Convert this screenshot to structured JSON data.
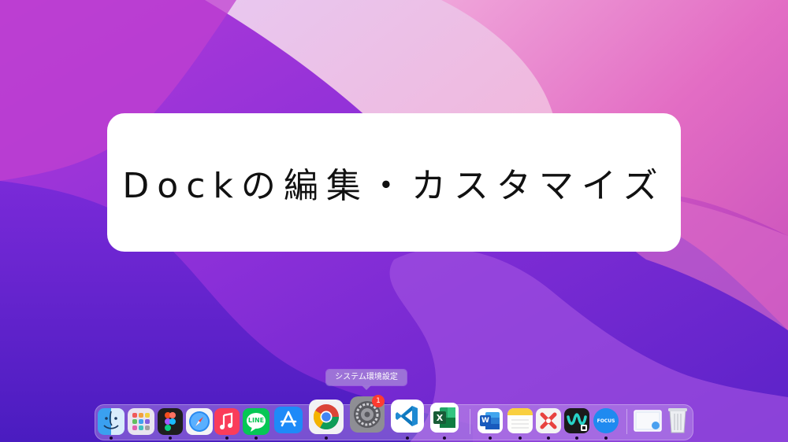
{
  "title": {
    "text": "Dockの編集・カスタマイズ"
  },
  "tooltip": {
    "text": "システム環境設定"
  },
  "dock": {
    "apps": [
      {
        "name": "Finder",
        "icon": "finder-icon",
        "running": true
      },
      {
        "name": "Launchpad",
        "icon": "launchpad-icon",
        "running": false
      },
      {
        "name": "Figma",
        "icon": "figma-icon",
        "running": true
      },
      {
        "name": "Safari",
        "icon": "safari-icon",
        "running": false
      },
      {
        "name": "Music",
        "icon": "music-icon",
        "running": true
      },
      {
        "name": "LINE",
        "icon": "line-icon",
        "label": "LINE",
        "running": true
      },
      {
        "name": "App Store",
        "icon": "app-store-icon",
        "running": false
      },
      {
        "name": "Chrome",
        "icon": "chrome-icon",
        "running": true
      },
      {
        "name": "System Preferences",
        "icon": "system-preferences-icon",
        "badge": "1",
        "running": false
      },
      {
        "name": "Visual Studio Code",
        "icon": "vscode-icon",
        "running": true
      },
      {
        "name": "Excel",
        "icon": "excel-icon",
        "label": "X",
        "running": true
      },
      {
        "name": "Word",
        "icon": "word-icon",
        "label": "W",
        "running": true
      },
      {
        "name": "Notes",
        "icon": "notes-icon",
        "running": true
      },
      {
        "name": "Xmind",
        "icon": "xmind-icon",
        "running": true
      },
      {
        "name": "Webex",
        "icon": "webex-icon",
        "running": true
      },
      {
        "name": "Focus",
        "icon": "focus-icon",
        "label": "FOCUS",
        "running": true
      },
      {
        "name": "Screenshot",
        "icon": "screenshot-stack-icon",
        "running": false
      },
      {
        "name": "Trash",
        "icon": "trash-icon",
        "running": false
      }
    ]
  },
  "colors": {
    "accent_magenta": "#e040c0",
    "accent_purple": "#6a2bd0",
    "badge": "#ff3b30"
  }
}
